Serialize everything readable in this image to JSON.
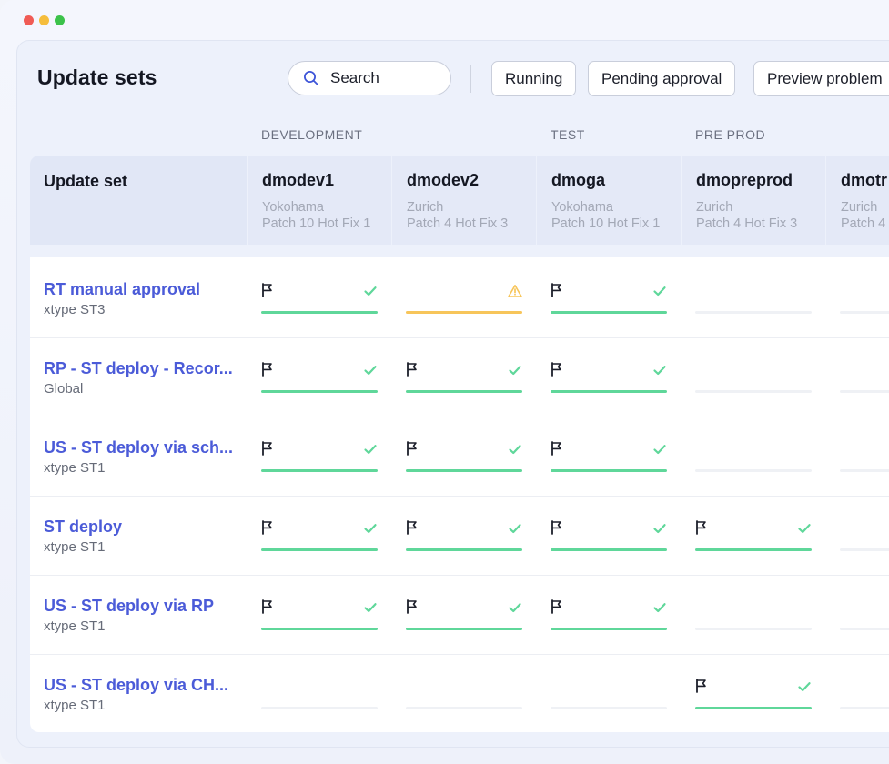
{
  "page": {
    "title": "Update sets",
    "search_placeholder": "Search",
    "filters": [
      "Running",
      "Pending approval",
      "Preview problem"
    ]
  },
  "groups": [
    "DEVELOPMENT",
    "TEST",
    "PRE PROD"
  ],
  "table": {
    "first_column_header": "Update set",
    "environments": [
      {
        "name": "dmodev1",
        "release": "Yokohama",
        "patch": "Patch 10 Hot Fix 1"
      },
      {
        "name": "dmodev2",
        "release": "Zurich",
        "patch": "Patch 4 Hot Fix 3"
      },
      {
        "name": "dmoga",
        "release": "Yokohama",
        "patch": "Patch 10 Hot Fix 1"
      },
      {
        "name": "dmopreprod",
        "release": "Zurich",
        "patch": "Patch 4 Hot Fix 3"
      },
      {
        "name": "dmotr",
        "release": "Zurich",
        "patch": "Patch 4"
      }
    ],
    "rows": [
      {
        "title": "RT manual approval",
        "subtitle": "xtype ST3",
        "cells": [
          "done",
          "warning",
          "done",
          "empty",
          "empty"
        ]
      },
      {
        "title": "RP - ST deploy - Recor...",
        "subtitle": "Global",
        "cells": [
          "done",
          "done",
          "done",
          "empty",
          "empty"
        ]
      },
      {
        "title": "US - ST deploy via sch...",
        "subtitle": "xtype ST1",
        "cells": [
          "done",
          "done",
          "done",
          "empty",
          "empty"
        ]
      },
      {
        "title": "ST deploy",
        "subtitle": "xtype ST1",
        "cells": [
          "done",
          "done",
          "done",
          "done",
          "empty"
        ]
      },
      {
        "title": "US - ST deploy via RP",
        "subtitle": "xtype ST1",
        "cells": [
          "done",
          "done",
          "done",
          "empty",
          "empty"
        ]
      },
      {
        "title": "US - ST deploy via CH...",
        "subtitle": "xtype ST1",
        "cells": [
          "empty",
          "empty",
          "empty",
          "done",
          "empty"
        ]
      }
    ]
  },
  "colors": {
    "accent_link": "#4b5bd8",
    "success": "#5fd79a",
    "warning": "#f7c55a",
    "traffic_red": "#f05b55",
    "traffic_yellow": "#f5bd3c",
    "traffic_green": "#3bc24a"
  }
}
